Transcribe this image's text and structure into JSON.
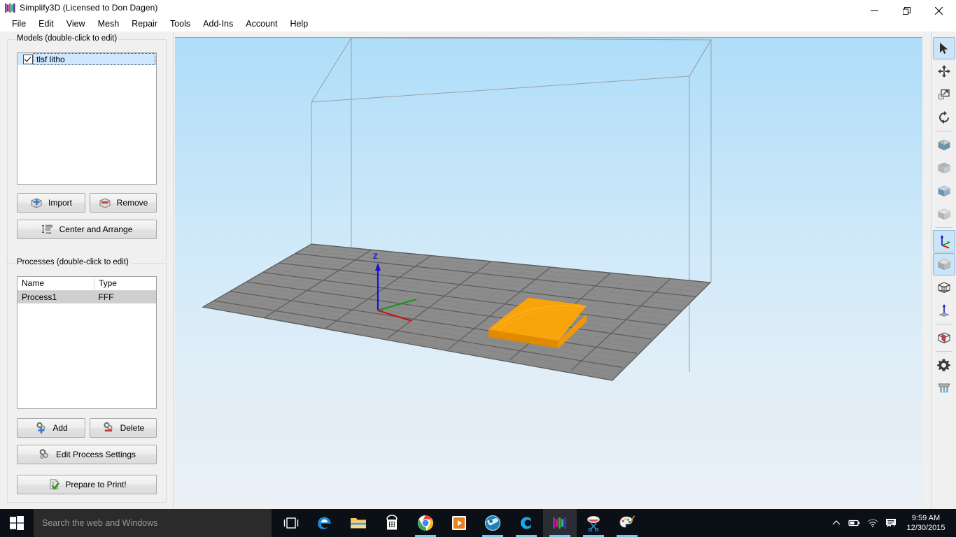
{
  "window": {
    "title": "Simplify3D (Licensed to Don Dagen)",
    "logo_name": "simplify3d-logo",
    "minimize_glyph": "—",
    "maximize_glyph": "❐",
    "close_glyph": "✕"
  },
  "menubar": {
    "items": [
      {
        "label": "File"
      },
      {
        "label": "Edit"
      },
      {
        "label": "View"
      },
      {
        "label": "Mesh"
      },
      {
        "label": "Repair"
      },
      {
        "label": "Tools"
      },
      {
        "label": "Add-Ins"
      },
      {
        "label": "Account"
      },
      {
        "label": "Help"
      }
    ]
  },
  "models_panel": {
    "title": "Models (double-click to edit)",
    "items": [
      {
        "name": "tlsf litho",
        "checked": true,
        "selected": true
      }
    ],
    "buttons": {
      "import": "Import",
      "remove": "Remove",
      "center_and_arrange": "Center and Arrange"
    }
  },
  "processes_panel": {
    "title": "Processes (double-click to edit)",
    "columns": [
      "Name",
      "Type"
    ],
    "rows": [
      {
        "name": "Process1",
        "type": "FFF",
        "selected": true
      }
    ],
    "buttons": {
      "add": "Add",
      "delete": "Delete",
      "edit_process_settings": "Edit Process Settings",
      "prepare_to_print": "Prepare to Print!"
    }
  },
  "viewport": {
    "axis_label_z": "Z",
    "model_color": "#f5a000",
    "build_plate_color": "#8c8c8c",
    "wireframe_color": "#9aa0a6",
    "background_top": "#aeddf9",
    "background_bottom": "#e9eff7"
  },
  "right_toolbar": {
    "tools": [
      {
        "name": "select-tool-icon",
        "active": true
      },
      {
        "name": "move-tool-icon",
        "active": false
      },
      {
        "name": "scale-tool-icon",
        "active": false
      },
      {
        "name": "rotate-tool-icon",
        "active": false
      },
      {
        "name": "view-front-icon",
        "active": false
      },
      {
        "name": "view-back-icon",
        "active": false
      },
      {
        "name": "view-left-icon",
        "active": false
      },
      {
        "name": "view-right-icon",
        "active": false
      },
      {
        "name": "view-axes-icon",
        "active": true
      },
      {
        "name": "view-solid-icon",
        "active": true
      },
      {
        "name": "view-wireframe-icon",
        "active": false
      },
      {
        "name": "view-normals-icon",
        "active": false
      },
      {
        "name": "cross-section-icon",
        "active": false
      },
      {
        "name": "settings-gear-icon",
        "active": false
      },
      {
        "name": "extruder-icon",
        "active": false
      }
    ]
  },
  "taskbar": {
    "start_name": "windows-start-icon",
    "search_placeholder": "Search the web and Windows",
    "apps": [
      {
        "name": "task-view-icon",
        "running": false,
        "active": false
      },
      {
        "name": "edge-icon",
        "running": false,
        "active": false
      },
      {
        "name": "file-explorer-icon",
        "running": false,
        "active": false
      },
      {
        "name": "store-icon",
        "running": false,
        "active": false
      },
      {
        "name": "chrome-icon",
        "running": true,
        "active": false
      },
      {
        "name": "movies-tv-icon",
        "running": false,
        "active": false
      },
      {
        "name": "browser-icon",
        "running": true,
        "active": false
      },
      {
        "name": "curse-icon",
        "running": true,
        "active": false
      },
      {
        "name": "simplify3d-icon",
        "running": true,
        "active": true
      },
      {
        "name": "snipping-tool-icon",
        "running": true,
        "active": false
      },
      {
        "name": "paint-icon",
        "running": true,
        "active": false
      }
    ],
    "tray": [
      {
        "name": "show-hidden-icons-chevron"
      },
      {
        "name": "battery-icon"
      },
      {
        "name": "wifi-icon"
      },
      {
        "name": "volume-icon"
      },
      {
        "name": "action-center-icon"
      }
    ],
    "clock": {
      "time": "9:59 AM",
      "date": "12/30/2015"
    }
  }
}
